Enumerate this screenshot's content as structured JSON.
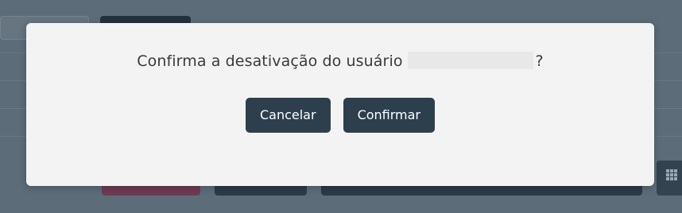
{
  "dialog": {
    "message_prefix": "Confirma a desativação do usuário",
    "message_suffix": "?",
    "cancel_label": "Cancelar",
    "confirm_label": "Confirmar"
  },
  "colors": {
    "overlay": "#5c6d79",
    "modal_background": "#f3f3f3",
    "button_background": "#2d3f4d",
    "button_text": "#ffffff"
  },
  "icons": {
    "grid_button": "grid-icon"
  }
}
